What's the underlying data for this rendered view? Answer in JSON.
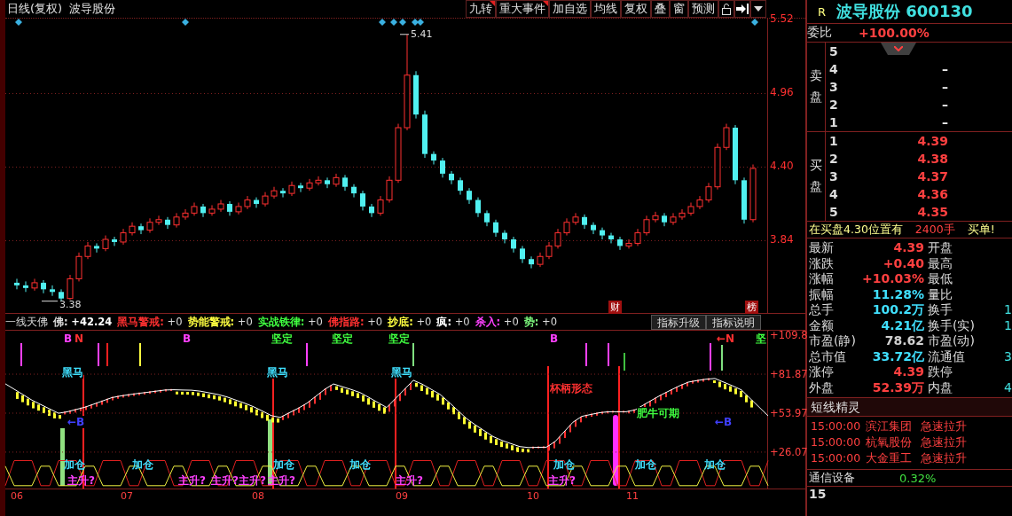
{
  "chart_header": {
    "period": "日线(复权)",
    "stock": "波导股份"
  },
  "toolbar": [
    {
      "label": "九转",
      "flagged": true
    },
    {
      "label": "重大事件",
      "flagged": true
    },
    {
      "label": "加自选",
      "flagged": false
    },
    {
      "label": "均线",
      "flagged": false
    },
    {
      "label": "复权",
      "flagged": false
    },
    {
      "label": "叠",
      "flagged": false
    },
    {
      "label": "窗",
      "flagged": false
    },
    {
      "label": "预测",
      "flagged": false
    }
  ],
  "price_chart": {
    "chart_data": {
      "type": "candlestick",
      "ylim": [
        3.29,
        5.53
      ],
      "grid": true,
      "yticks": [
        {
          "value": 5.52,
          "label": "5.52"
        },
        {
          "value": 4.96,
          "label": "4.96"
        },
        {
          "value": 4.4,
          "label": "4.40"
        },
        {
          "value": 3.84,
          "label": "3.84"
        }
      ],
      "ohlc": [
        [
          3.52,
          3.55,
          3.47,
          3.5
        ],
        [
          3.5,
          3.53,
          3.45,
          3.48
        ],
        [
          3.48,
          3.55,
          3.46,
          3.52
        ],
        [
          3.52,
          3.54,
          3.44,
          3.47
        ],
        [
          3.47,
          3.5,
          3.42,
          3.45
        ],
        [
          3.45,
          3.47,
          3.38,
          3.4
        ],
        [
          3.4,
          3.58,
          3.39,
          3.55
        ],
        [
          3.55,
          3.75,
          3.53,
          3.72
        ],
        [
          3.72,
          3.83,
          3.7,
          3.8
        ],
        [
          3.8,
          3.82,
          3.75,
          3.78
        ],
        [
          3.78,
          3.88,
          3.76,
          3.85
        ],
        [
          3.85,
          3.87,
          3.8,
          3.83
        ],
        [
          3.83,
          3.93,
          3.81,
          3.9
        ],
        [
          3.9,
          3.98,
          3.88,
          3.95
        ],
        [
          3.95,
          3.97,
          3.89,
          3.92
        ],
        [
          3.92,
          4.01,
          3.9,
          3.98
        ],
        [
          3.98,
          4.03,
          3.96,
          4.0
        ],
        [
          4.0,
          4.02,
          3.93,
          3.96
        ],
        [
          3.96,
          4.05,
          3.94,
          4.02
        ],
        [
          4.02,
          4.08,
          4.0,
          4.05
        ],
        [
          4.05,
          4.13,
          4.03,
          4.1
        ],
        [
          4.1,
          4.12,
          4.02,
          4.05
        ],
        [
          4.05,
          4.11,
          4.03,
          4.08
        ],
        [
          4.08,
          4.15,
          4.06,
          4.12
        ],
        [
          4.12,
          4.14,
          4.03,
          4.06
        ],
        [
          4.06,
          4.13,
          4.04,
          4.1
        ],
        [
          4.1,
          4.18,
          4.08,
          4.15
        ],
        [
          4.15,
          4.17,
          4.09,
          4.12
        ],
        [
          4.12,
          4.21,
          4.1,
          4.18
        ],
        [
          4.18,
          4.25,
          4.16,
          4.22
        ],
        [
          4.22,
          4.24,
          4.17,
          4.2
        ],
        [
          4.2,
          4.29,
          4.18,
          4.26
        ],
        [
          4.26,
          4.28,
          4.21,
          4.24
        ],
        [
          4.24,
          4.31,
          4.22,
          4.28
        ],
        [
          4.28,
          4.33,
          4.26,
          4.3
        ],
        [
          4.3,
          4.32,
          4.24,
          4.27
        ],
        [
          4.27,
          4.35,
          4.25,
          4.32
        ],
        [
          4.32,
          4.34,
          4.22,
          4.25
        ],
        [
          4.25,
          4.27,
          4.17,
          4.2
        ],
        [
          4.2,
          4.22,
          4.07,
          4.1
        ],
        [
          4.1,
          4.12,
          4.02,
          4.05
        ],
        [
          4.05,
          4.18,
          4.03,
          4.15
        ],
        [
          4.15,
          4.33,
          4.13,
          4.3
        ],
        [
          4.3,
          4.73,
          4.28,
          4.7
        ],
        [
          4.7,
          5.41,
          4.68,
          5.1
        ],
        [
          5.1,
          5.13,
          4.77,
          4.8
        ],
        [
          4.8,
          4.83,
          4.47,
          4.5
        ],
        [
          4.5,
          4.52,
          4.42,
          4.45
        ],
        [
          4.45,
          4.47,
          4.32,
          4.35
        ],
        [
          4.35,
          4.37,
          4.27,
          4.3
        ],
        [
          4.3,
          4.32,
          4.19,
          4.22
        ],
        [
          4.22,
          4.24,
          4.12,
          4.15
        ],
        [
          4.15,
          4.17,
          4.02,
          4.05
        ],
        [
          4.05,
          4.07,
          3.95,
          3.98
        ],
        [
          3.98,
          4.0,
          3.87,
          3.9
        ],
        [
          3.9,
          3.92,
          3.82,
          3.85
        ],
        [
          3.85,
          3.87,
          3.75,
          3.78
        ],
        [
          3.78,
          3.8,
          3.67,
          3.7
        ],
        [
          3.7,
          3.72,
          3.63,
          3.66
        ],
        [
          3.66,
          3.75,
          3.64,
          3.72
        ],
        [
          3.72,
          3.83,
          3.7,
          3.8
        ],
        [
          3.8,
          3.93,
          3.78,
          3.9
        ],
        [
          3.9,
          4.01,
          3.88,
          3.98
        ],
        [
          3.98,
          4.05,
          3.96,
          4.02
        ],
        [
          4.02,
          4.04,
          3.93,
          3.96
        ],
        [
          3.96,
          3.98,
          3.89,
          3.92
        ],
        [
          3.92,
          3.94,
          3.85,
          3.88
        ],
        [
          3.88,
          3.9,
          3.82,
          3.85
        ],
        [
          3.85,
          3.87,
          3.77,
          3.8
        ],
        [
          3.8,
          3.85,
          3.78,
          3.82
        ],
        [
          3.82,
          3.93,
          3.8,
          3.9
        ],
        [
          3.9,
          4.03,
          3.88,
          4.0
        ],
        [
          4.0,
          4.06,
          3.98,
          4.03
        ],
        [
          4.03,
          4.05,
          3.95,
          3.98
        ],
        [
          3.98,
          4.05,
          3.96,
          4.02
        ],
        [
          4.02,
          4.08,
          4.0,
          4.05
        ],
        [
          4.05,
          4.13,
          4.03,
          4.1
        ],
        [
          4.1,
          4.18,
          4.08,
          4.15
        ],
        [
          4.15,
          4.28,
          4.13,
          4.25
        ],
        [
          4.25,
          4.58,
          4.23,
          4.55
        ],
        [
          4.55,
          4.73,
          4.53,
          4.7
        ],
        [
          4.7,
          4.72,
          4.27,
          4.3
        ],
        [
          4.3,
          4.32,
          3.97,
          4.0
        ],
        [
          4.0,
          4.42,
          3.98,
          4.39
        ]
      ]
    }
  },
  "price_marks": {
    "high": "5.41",
    "low": "3.38"
  },
  "event_badges": [
    "财",
    "榜"
  ],
  "indicator": {
    "name": "一线天佛",
    "readings": [
      {
        "value": "+42.24",
        "color": "#ffffff"
      },
      {
        "label": "黑马警戒:",
        "value": "+0",
        "color": "#ff3030"
      },
      {
        "label": "势能警戒:",
        "value": "+0",
        "color": "#ffff40"
      },
      {
        "label": "实战铁律:",
        "value": "+0",
        "color": "#40ff40"
      },
      {
        "label": "佛指路:",
        "value": "+0",
        "color": "#ff3030"
      },
      {
        "label": "抄底:",
        "value": "+0",
        "color": "#ffff40"
      },
      {
        "label": "疯:",
        "value": "+0",
        "color": "#ffffff"
      },
      {
        "label": "杀入:",
        "value": "+0",
        "color": "#ff40ff"
      },
      {
        "label": "势:",
        "value": "+0",
        "color": "#80ff80"
      }
    ],
    "buttons": [
      "指标升级",
      "指标说明"
    ],
    "chart_data": {
      "type": "line",
      "ylim": [
        0,
        113
      ],
      "grid": true,
      "yticks": [
        {
          "value": 109.8,
          "label": "+109.8"
        },
        {
          "value": 81.87,
          "label": "+81.87"
        },
        {
          "value": 53.97,
          "label": "+53.97"
        },
        {
          "value": 26.07,
          "label": "+26.07"
        }
      ],
      "series": [
        {
          "name": "佛:",
          "color": "#ffffff",
          "values": [
            75,
            71.1,
            67.2,
            63.3,
            60.1,
            57,
            53.9,
            55,
            56.6,
            58.3,
            60.5,
            62.8,
            65.1,
            66.3,
            67.2,
            68.1,
            68.9,
            69.7,
            70.5,
            70.7,
            70.5,
            70.4,
            69.7,
            68.5,
            67.3,
            65.6,
            63.3,
            61.1,
            58.5,
            55.4,
            52.2,
            50.9,
            54.2,
            57.4,
            61.1,
            66,
            71,
            74.9,
            72.9,
            70.9,
            68.7,
            65.2,
            61.6,
            58,
            64.5,
            71,
            77.5,
            74.7,
            71.1,
            67.5,
            61.9,
            56,
            50.1,
            45.5,
            41.4,
            37.2,
            34.4,
            32.2,
            30,
            29.3,
            29.5,
            29.6,
            33.7,
            40.6,
            47.5,
            51.7,
            53,
            54.3,
            55,
            55,
            55,
            56.3,
            60,
            63.7,
            67.2,
            70.4,
            73.5,
            76.2,
            77.3,
            78.3,
            78.8,
            76.2,
            73.5,
            70.6,
            64.4,
            58.2,
            52
          ]
        },
        {
          "color": "#e02020",
          "values": [
            2,
            20,
            20,
            20,
            2,
            2,
            20,
            20,
            20,
            2,
            2,
            20,
            20,
            20,
            2,
            2,
            20,
            20,
            20,
            2,
            2,
            20,
            20,
            20,
            2,
            2,
            20,
            20,
            20,
            2,
            2,
            20,
            20,
            20,
            2,
            2,
            20,
            20,
            20,
            2,
            2,
            20,
            20,
            20,
            2,
            2,
            20,
            20,
            20,
            2,
            2,
            20,
            20,
            20,
            2,
            2,
            20,
            20,
            20,
            2,
            2,
            20,
            20,
            20,
            2,
            2,
            20,
            20,
            20,
            2,
            2,
            20,
            20,
            20,
            2,
            2,
            20,
            20,
            20,
            2,
            2,
            20,
            20,
            20,
            2,
            2,
            20
          ]
        },
        {
          "color": "#f0f040",
          "values": [
            16,
            2,
            2,
            2,
            16,
            16,
            2,
            2,
            2,
            16,
            16,
            2,
            2,
            2,
            16,
            16,
            2,
            2,
            2,
            16,
            16,
            2,
            2,
            2,
            16,
            16,
            2,
            2,
            2,
            16,
            16,
            2,
            2,
            2,
            16,
            16,
            2,
            2,
            2,
            16,
            16,
            2,
            2,
            2,
            16,
            16,
            2,
            2,
            2,
            16,
            16,
            2,
            2,
            2,
            16,
            16,
            2,
            2,
            2,
            16,
            16,
            2,
            2,
            2,
            16,
            16,
            2,
            2,
            2,
            16,
            16,
            2,
            2,
            2,
            16,
            16,
            2,
            2,
            2,
            16,
            16,
            2,
            2,
            2,
            16,
            16,
            2
          ]
        }
      ]
    },
    "signals": [
      {
        "text": "B",
        "color": "#ff40ff"
      },
      {
        "text": "N",
        "color": "#ff3030"
      },
      {
        "text": "B",
        "color": "#ff40ff"
      },
      {
        "text": "坚定",
        "color": "#40ff40"
      },
      {
        "text": "坚定",
        "color": "#40ff40"
      },
      {
        "text": "坚定",
        "color": "#40ff40"
      },
      {
        "text": "B",
        "color": "#ff40ff"
      },
      {
        "text": "←N",
        "color": "#ff3030"
      },
      {
        "text": "坚",
        "color": "#40ff40"
      },
      {
        "text": "黑马",
        "color": "#40e0ff"
      },
      {
        "text": "黑马",
        "color": "#40e0ff"
      },
      {
        "text": "黑马",
        "color": "#40e0ff"
      },
      {
        "text": "杯柄形态",
        "color": "#ff3030"
      },
      {
        "text": "←B",
        "color": "#4040ff"
      },
      {
        "text": "肥牛可期",
        "color": "#40ff40"
      },
      {
        "text": "←B",
        "color": "#4040ff"
      },
      {
        "text": "加仓",
        "color": "#40e0ff"
      },
      {
        "text": "加仓",
        "color": "#40e0ff"
      },
      {
        "text": "加仓",
        "color": "#40e0ff"
      },
      {
        "text": "加仓",
        "color": "#40e0ff"
      },
      {
        "text": "加仓",
        "color": "#40e0ff"
      },
      {
        "text": "加仓",
        "color": "#40e0ff"
      },
      {
        "text": "加仓",
        "color": "#40e0ff"
      },
      {
        "text": "主升?",
        "color": "#ff40ff"
      },
      {
        "text": "主升?",
        "color": "#ff40ff"
      },
      {
        "text": "主升?主升?",
        "color": "#ff40ff"
      },
      {
        "text": "主升?",
        "color": "#ff40ff"
      },
      {
        "text": "主升?",
        "color": "#ff40ff"
      },
      {
        "text": "主升?",
        "color": "#ff40ff"
      }
    ]
  },
  "date_axis": [
    "06",
    "07",
    "08",
    "09",
    "10",
    "11"
  ],
  "quote": {
    "flag": "R",
    "name": "波导股份",
    "code": "600130",
    "ratio": {
      "label": "委比",
      "value": "+100.00%"
    },
    "sell_label": "卖盘",
    "buy_label": "买盘",
    "sell": [
      {
        "level": "5"
      },
      {
        "level": "4",
        "price": "–"
      },
      {
        "level": "3",
        "price": "–"
      },
      {
        "level": "2",
        "price": "–"
      },
      {
        "level": "1",
        "price": "–"
      }
    ],
    "buy": [
      {
        "level": "1",
        "price": "4.39"
      },
      {
        "level": "2",
        "price": "4.38"
      },
      {
        "level": "3",
        "price": "4.37"
      },
      {
        "level": "4",
        "price": "4.36"
      },
      {
        "level": "5",
        "price": "4.35"
      }
    ],
    "ticker": {
      "text": "在买盘4.30位置有",
      "amount": "2400手",
      "note": "买单!"
    },
    "stats": [
      {
        "label": "最新",
        "value": "4.39",
        "color": "#ff4040",
        "label2": "开盘"
      },
      {
        "label": "涨跌",
        "value": "+0.40",
        "color": "#ff4040",
        "label2": "最高"
      },
      {
        "label": "涨幅",
        "value": "+10.03%",
        "color": "#ff4040",
        "label2": "最低"
      },
      {
        "label": "振幅",
        "value": "11.28%",
        "color": "#40e0ff",
        "label2": "量比"
      },
      {
        "label": "总手",
        "value": "100.2万",
        "color": "#40e0ff",
        "label2": "换手",
        "value2": "1"
      },
      {
        "label": "金额",
        "value": "4.21亿",
        "color": "#40e0ff",
        "label2": "换手(实)",
        "value2": "1"
      },
      {
        "label": "市盈(静)",
        "value": "78.62",
        "color": "#d0d0d0",
        "label2": "市盈(动)"
      },
      {
        "label": "总市值",
        "value": "33.72亿",
        "color": "#40e0ff",
        "label2": "流通值",
        "value2": "3"
      },
      {
        "label": "涨停",
        "value": "4.39",
        "color": "#ff4040",
        "label2": "跌停"
      },
      {
        "label": "外盘",
        "value": "52.39万",
        "color": "#ff4040",
        "label2": "内盘",
        "value2": "4"
      }
    ],
    "sprite_title": "短线精灵",
    "sprite": [
      {
        "time": "15:00:00",
        "stock": "滨江集团",
        "event": "急速拉升"
      },
      {
        "time": "15:00:00",
        "stock": "杭氧股份",
        "event": "急速拉升"
      },
      {
        "time": "15:00:00",
        "stock": "大金重工",
        "event": "急速拉升"
      }
    ],
    "sector": {
      "name": "通信设备",
      "change": "0.32%"
    },
    "footer_number": "15"
  }
}
